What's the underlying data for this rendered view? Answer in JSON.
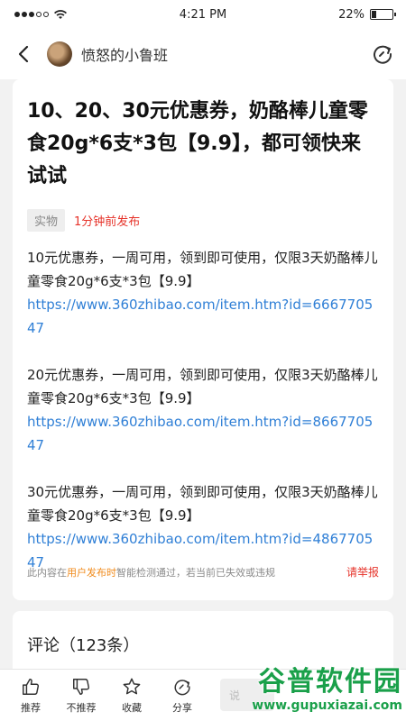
{
  "status_bar": {
    "time": "4:21 PM",
    "battery_percent": "22%",
    "battery_level": 0.22
  },
  "nav": {
    "author": "愤怒的小鲁班"
  },
  "post": {
    "title": "10、20、30元优惠券，奶酪棒儿童零食20g*6支*3包【9.9】，都可领快来试试",
    "tag": "实物",
    "posted": "1分钟前发布",
    "paragraphs": [
      {
        "text": "10元优惠券，一周可用，领到即可使用，仅限3天奶酪棒儿童零食20g*6支*3包【9.9】",
        "link": "https://www.360zhibao.com/item.htm?id=666770547"
      },
      {
        "text": "20元优惠券，一周可用，领到即可使用，仅限3天奶酪棒儿童零食20g*6支*3包【9.9】",
        "link": "https://www.360zhibao.com/item.htm?id=866770547"
      },
      {
        "text": "30元优惠券，一周可用，领到即可使用，仅限3天奶酪棒儿童零食20g*6支*3包【9.9】",
        "link": "https://www.360zhibao.com/item.htm?id=486770547"
      }
    ],
    "notice_prefix": "此内容在",
    "notice_highlight": "用户发布时",
    "notice_suffix": "智能检测通过，若当前已失效或违规",
    "report": "请举报"
  },
  "comments": {
    "title": "评论（123条）"
  },
  "bottom_bar": {
    "recommend": "推荐",
    "not_recommend": "不推荐",
    "favorite": "收藏",
    "share": "分享",
    "input_placeholder": "说"
  },
  "watermark": {
    "name": "谷普软件园",
    "url": "www.gupuxiazai.com"
  },
  "colors": {
    "link": "#2f7fd6",
    "red": "#e6332a",
    "orange": "#f08a1a",
    "watermark": "#1aa04a"
  }
}
